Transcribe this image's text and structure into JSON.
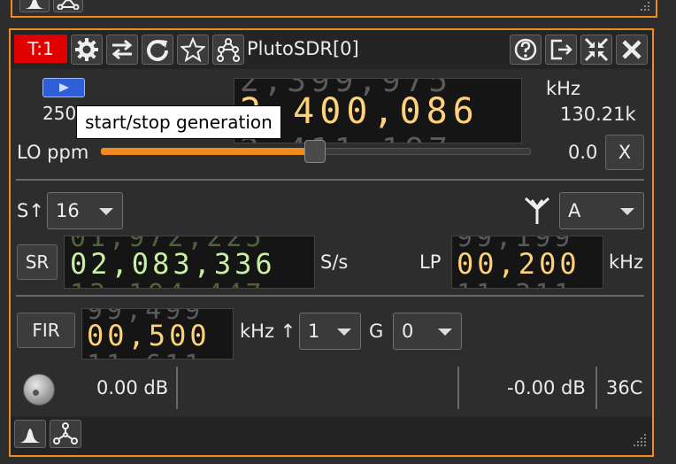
{
  "top_toolbar": {
    "spectrum_icon": "spectrum-icon",
    "network_icon": "network-icon"
  },
  "title_bar": {
    "tab_badge": "T:1",
    "device_name": "PlutoSDR[0]",
    "badge_color": "#e00000"
  },
  "header": {
    "sample_rate_prefix": "250",
    "center_frequency_digits": "2,400,086",
    "frequency_unit": "kHz",
    "ppm_readout": "130.21k",
    "tooltip": "start/stop generation"
  },
  "lo_ppm": {
    "label": "LO ppm",
    "value": "0.0",
    "reset_button": "X",
    "slider_level": 0.56
  },
  "settings": {
    "swap_label": "S↑",
    "swap_value": "16",
    "antenna_value": "A",
    "sr_button": "SR",
    "sr_value": "02,083,336",
    "sr_unit": "S/s",
    "lp_label": "LP",
    "lp_value": "00,200",
    "lp_unit": "kHz",
    "fir_button": "FIR",
    "fir_value": "00,500",
    "fir_unit": "kHz ↑",
    "fir_gain_value": "1",
    "g_label": "G",
    "g_value": "0"
  },
  "status": {
    "attenuation": "0.00 dB",
    "power": "-0.00 dB",
    "temperature": "36C"
  },
  "colors": {
    "accent": "#f08c1e",
    "dial_yellow": "#ffd27a",
    "dial_green": "#c8f0a0"
  }
}
